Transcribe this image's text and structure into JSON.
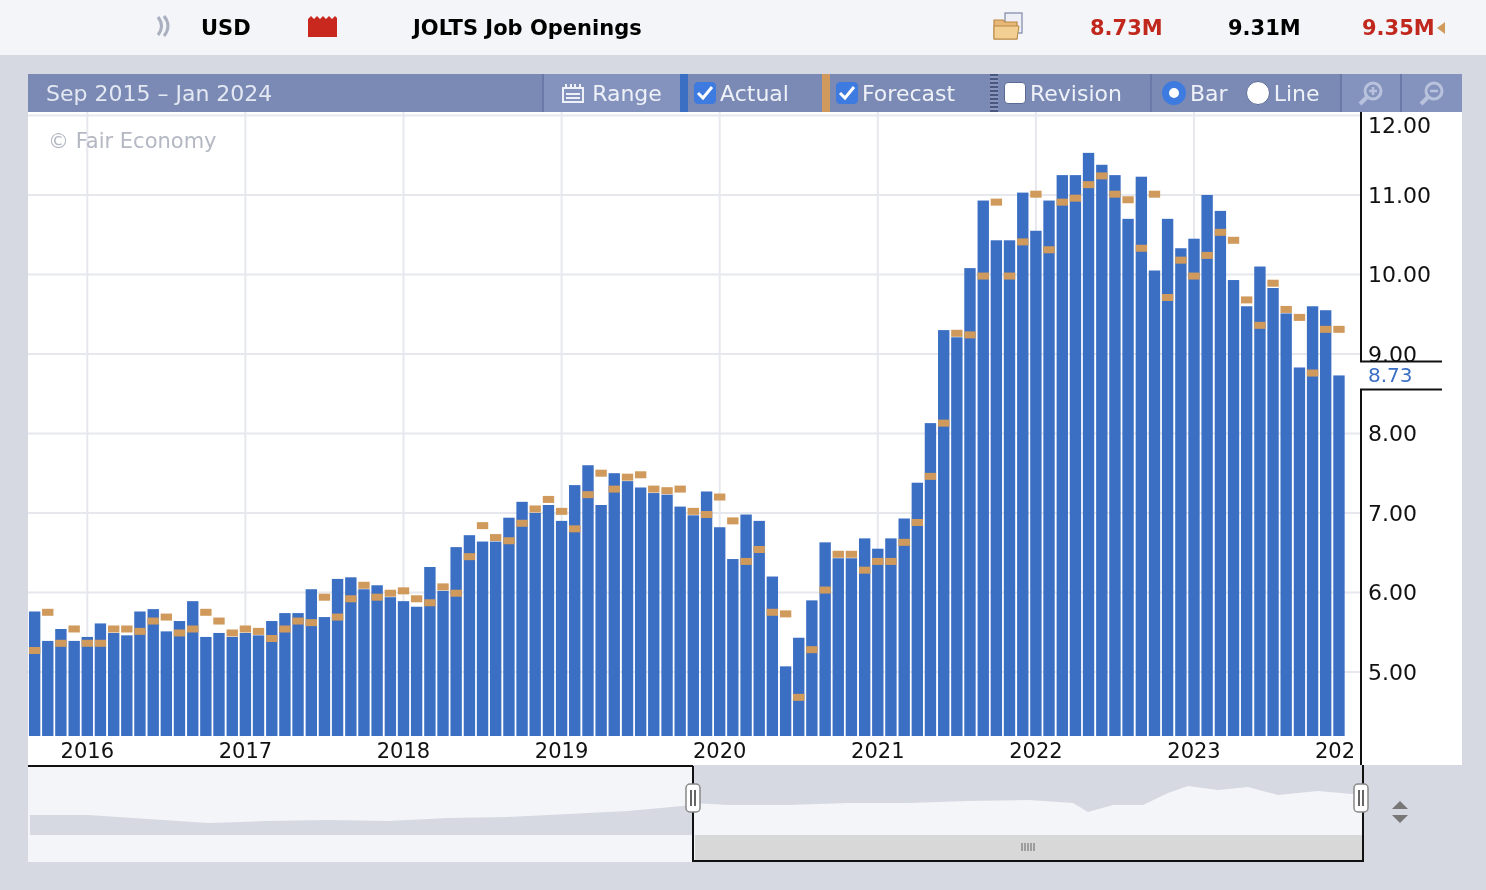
{
  "header": {
    "currency": "USD",
    "event": "JOLTS Job Openings",
    "actual": {
      "text": "8.73M",
      "color": "#c0281e"
    },
    "forecast": "9.31M",
    "previous": {
      "text": "9.35M",
      "color": "#c0281e",
      "revised": true
    }
  },
  "toolbar": {
    "range_text": "Sep 2015 – Jan 2024",
    "range_button": "Range",
    "series_toggles": [
      {
        "checked": true
      },
      {
        "checked": true
      },
      {
        "label": "Revision",
        "checked": false
      }
    ],
    "chart_types": [
      {
        "label": "Bar",
        "selected": true
      },
      {
        "label": "Line",
        "selected": false
      }
    ]
  },
  "chart": {
    "credit": "© Fair Economy",
    "cut_axis_label": "202",
    "last_value_label": "8.73",
    "chart_data": {
      "type": "bar",
      "xlim": [
        2015.625,
        2024.05
      ],
      "x": [
        2015.667,
        2015.75,
        2015.833,
        2015.917,
        2016.0,
        2016.083,
        2016.167,
        2016.25,
        2016.333,
        2016.417,
        2016.5,
        2016.583,
        2016.667,
        2016.75,
        2016.833,
        2016.917,
        2017.0,
        2017.083,
        2017.167,
        2017.25,
        2017.333,
        2017.417,
        2017.5,
        2017.583,
        2017.667,
        2017.75,
        2017.833,
        2017.917,
        2018.0,
        2018.083,
        2018.167,
        2018.25,
        2018.333,
        2018.417,
        2018.5,
        2018.583,
        2018.667,
        2018.75,
        2018.833,
        2018.917,
        2019.0,
        2019.083,
        2019.167,
        2019.25,
        2019.333,
        2019.417,
        2019.5,
        2019.583,
        2019.667,
        2019.75,
        2019.833,
        2019.917,
        2020.0,
        2020.083,
        2020.167,
        2020.25,
        2020.333,
        2020.417,
        2020.5,
        2020.583,
        2020.667,
        2020.75,
        2020.833,
        2020.917,
        2021.0,
        2021.083,
        2021.167,
        2021.25,
        2021.333,
        2021.417,
        2021.5,
        2021.583,
        2021.667,
        2021.75,
        2021.833,
        2021.917,
        2022.0,
        2022.083,
        2022.167,
        2022.25,
        2022.333,
        2022.417,
        2022.5,
        2022.583,
        2022.667,
        2022.75,
        2022.833,
        2022.917,
        2023.0,
        2023.083,
        2023.167,
        2023.25,
        2023.333,
        2023.417,
        2023.5,
        2023.583,
        2023.667,
        2023.75,
        2023.833,
        2023.917
      ],
      "series": [
        {
          "name": "Actual",
          "color": "#3b6fc4",
          "values": [
            5.76,
            5.39,
            5.54,
            5.39,
            5.44,
            5.61,
            5.49,
            5.46,
            5.76,
            5.79,
            5.51,
            5.64,
            5.89,
            5.44,
            5.49,
            5.44,
            5.49,
            5.46,
            5.64,
            5.74,
            5.74,
            6.04,
            5.69,
            6.17,
            6.19,
            6.04,
            6.09,
            5.94,
            5.89,
            5.82,
            6.32,
            6.02,
            6.57,
            6.72,
            6.64,
            6.64,
            6.94,
            7.14,
            7.0,
            7.1,
            6.9,
            7.35,
            7.6,
            7.1,
            7.5,
            7.4,
            7.32,
            7.25,
            7.23,
            7.08,
            6.97,
            7.27,
            6.82,
            6.42,
            6.98,
            6.9,
            6.2,
            5.07,
            5.43,
            5.9,
            6.63,
            6.43,
            6.43,
            6.68,
            6.55,
            6.68,
            6.93,
            7.38,
            8.13,
            9.3,
            9.21,
            10.08,
            10.93,
            10.43,
            10.43,
            11.03,
            10.55,
            10.93,
            11.25,
            11.25,
            11.53,
            11.38,
            11.25,
            10.7,
            11.23,
            10.05,
            10.7,
            10.33,
            10.45,
            11.0,
            10.8,
            9.93,
            9.6,
            10.1,
            9.83,
            9.51,
            8.83,
            9.6,
            9.55,
            8.73
          ]
        },
        {
          "name": "Forecast",
          "type": "scatter",
          "color": "#d09a5c",
          "values": [
            5.27,
            5.75,
            5.36,
            5.54,
            5.36,
            5.36,
            5.54,
            5.54,
            5.51,
            5.64,
            5.69,
            5.49,
            5.54,
            5.75,
            5.64,
            5.49,
            5.54,
            5.51,
            5.42,
            5.54,
            5.64,
            5.62,
            5.94,
            5.69,
            5.92,
            6.09,
            5.94,
            5.99,
            6.02,
            5.92,
            5.87,
            6.07,
            5.99,
            6.45,
            6.84,
            6.69,
            6.65,
            6.87,
            7.05,
            7.17,
            7.02,
            6.8,
            7.23,
            7.5,
            7.3,
            7.45,
            7.48,
            7.3,
            7.28,
            7.3,
            7.02,
            6.98,
            7.2,
            6.9,
            6.39,
            6.54,
            5.75,
            5.73,
            4.68,
            5.28,
            6.03,
            6.48,
            6.48,
            6.28,
            6.39,
            6.39,
            6.63,
            6.88,
            7.46,
            8.13,
            9.26,
            9.24,
            9.98,
            10.91,
            9.98,
            10.41,
            11.01,
            10.31,
            10.91,
            10.96,
            11.13,
            11.24,
            11.01,
            10.94,
            10.33,
            11.01,
            9.71,
            10.18,
            9.98,
            10.24,
            10.53,
            10.43,
            9.68,
            9.36,
            9.89,
            9.56,
            9.46,
            8.76,
            9.31,
            9.31
          ]
        }
      ],
      "ylim": [
        4.2,
        12
      ],
      "grid": true,
      "yticks": [
        {
          "value": 5,
          "label": "5.00"
        },
        {
          "value": 6,
          "label": "6.00"
        },
        {
          "value": 7,
          "label": "7.00"
        },
        {
          "value": 8,
          "label": "8.00"
        },
        {
          "value": 9,
          "label": "9.00"
        },
        {
          "value": 10,
          "label": "10.00"
        },
        {
          "value": 11,
          "label": "11.00"
        },
        {
          "value": 12,
          "label": "12.00"
        }
      ],
      "xticks": [
        {
          "value": 2016,
          "label": "2016"
        },
        {
          "value": 2017,
          "label": "2017"
        },
        {
          "value": 2018,
          "label": "2018"
        },
        {
          "value": 2019,
          "label": "2019"
        },
        {
          "value": 2020,
          "label": "2020"
        },
        {
          "value": 2021,
          "label": "2021"
        },
        {
          "value": 2022,
          "label": "2022"
        },
        {
          "value": 2023,
          "label": "2023"
        }
      ]
    }
  }
}
